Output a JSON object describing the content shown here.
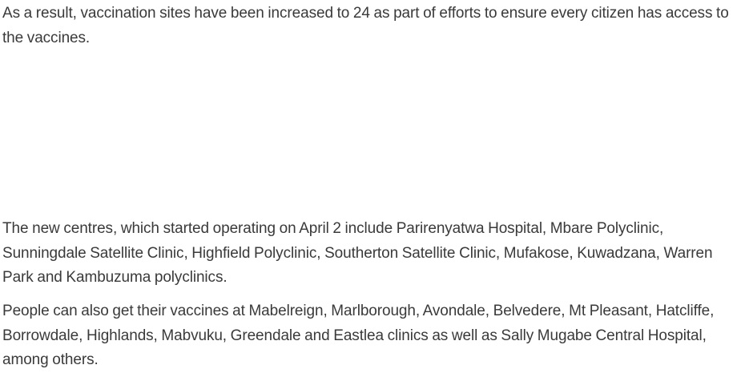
{
  "article": {
    "paragraphs": [
      "As a result, vaccination sites have been increased to 24 as part of efforts to ensure every citizen has access to the vaccines.",
      "The new centres, which started operating on April 2 include Parirenyatwa Hospital, Mbare Polyclinic, Sunningdale Satellite Clinic, Highfield Polyclinic, Southerton Satellite Clinic, Mufakose, Kuwadzana, Warren Park and Kambuzuma polyclinics.",
      "People can also get their vaccines at Mabelreign, Marlborough, Avondale, Belvedere, Mt Pleasant, Hatcliffe, Borrowdale, Highlands, Mabvuku, Greendale and Eastlea clinics as well as Sally Mugabe Central Hospital, among others."
    ]
  },
  "colors": {
    "text": "#3a3a3a",
    "background": "#ffffff"
  }
}
